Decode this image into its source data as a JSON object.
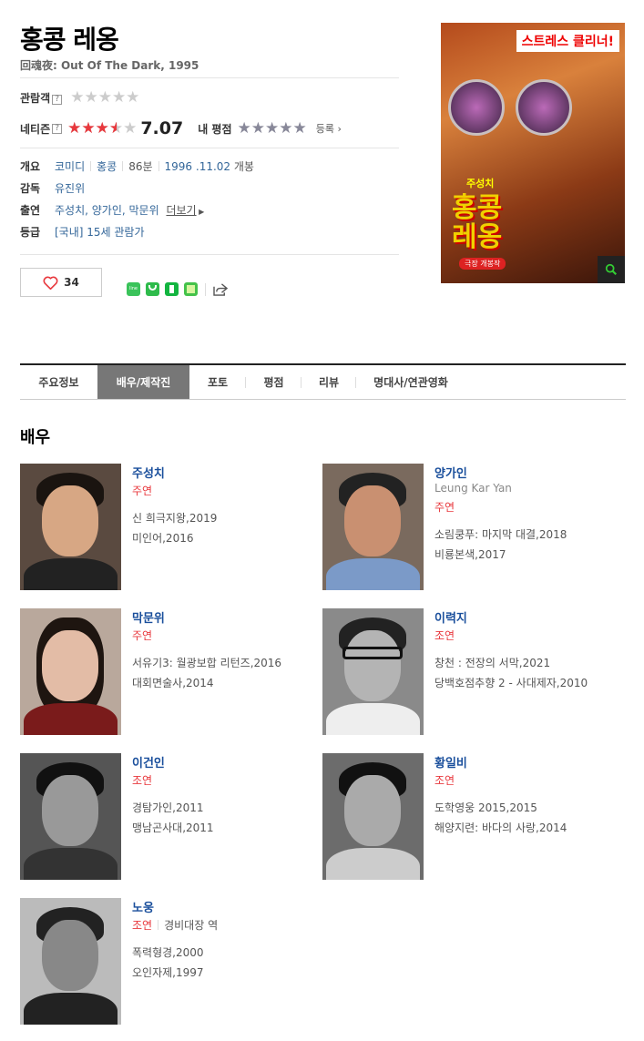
{
  "movie": {
    "title": "홍콩 레옹",
    "subtitle": "回魂夜: Out Of The Dark, 1995"
  },
  "ratings": {
    "audience_label": "관람객",
    "netizen_label": "네티즌",
    "netizen_score": "7.07",
    "netizen_score_value": 7.07,
    "my_rating_label": "내 평점",
    "register_label": "등록"
  },
  "info": {
    "overview_label": "개요",
    "genre": "코미디",
    "country": "홍콩",
    "runtime": "86분",
    "release_date": "1996 .11.02",
    "release_suffix": "개봉",
    "director_label": "감독",
    "director": "유진위",
    "cast_label": "출연",
    "cast": "주성치, 양가인, 막문위",
    "more_label": "더보기",
    "grade_label": "등급",
    "grade": "[국내] 15세 관람가"
  },
  "likes": {
    "count": "34"
  },
  "share_icons": [
    "line-icon",
    "band-icon",
    "bookmark-icon",
    "note-icon",
    "share-icon"
  ],
  "poster": {
    "top_text": "스트레스 클리너!",
    "star_name": "주성치",
    "title_text": "홍콩\n레옹",
    "badge": "극장 개봉작"
  },
  "tabs": [
    {
      "label": "주요정보",
      "active": false
    },
    {
      "label": "배우/제작진",
      "active": true
    },
    {
      "label": "포토",
      "active": false
    },
    {
      "label": "평점",
      "active": false
    },
    {
      "label": "리뷰",
      "active": false
    },
    {
      "label": "명대사/연관영화",
      "active": false
    }
  ],
  "section_title": "배우",
  "actors": [
    {
      "name": "주성치",
      "en": "",
      "role": "주연",
      "role_extra": "",
      "works": [
        "신 희극지왕,2019",
        "미인어,2016"
      ]
    },
    {
      "name": "양가인",
      "en": "Leung Kar Yan",
      "role": "주연",
      "role_extra": "",
      "works": [
        "소림쿵푸: 마지막 대결,2018",
        "비룡본색,2017"
      ]
    },
    {
      "name": "막문위",
      "en": "",
      "role": "주연",
      "role_extra": "",
      "works": [
        "서유기3: 월광보합 리턴즈,2016",
        "대회면술사,2014"
      ]
    },
    {
      "name": "이력지",
      "en": "",
      "role": "조연",
      "role_extra": "",
      "works": [
        "창천 : 전장의 서막,2021",
        "당백호점추향 2 - 사대제자,2010"
      ]
    },
    {
      "name": "이건인",
      "en": "",
      "role": "조연",
      "role_extra": "",
      "works": [
        "경탐가인,2011",
        "맹남곤사대,2011"
      ]
    },
    {
      "name": "황일비",
      "en": "",
      "role": "조연",
      "role_extra": "",
      "works": [
        "도학영웅 2015,2015",
        "해양지련: 바다의 사랑,2014"
      ]
    },
    {
      "name": "노웅",
      "en": "",
      "role": "조연",
      "role_extra": "경비대장 역",
      "works": [
        "폭력형경,2000",
        "오인자제,1997"
      ]
    }
  ],
  "colors": {
    "accent_red": "#e8383d",
    "link_blue": "#336699",
    "actor_name_blue": "#1a4f9c",
    "tab_active_bg": "#777777"
  }
}
